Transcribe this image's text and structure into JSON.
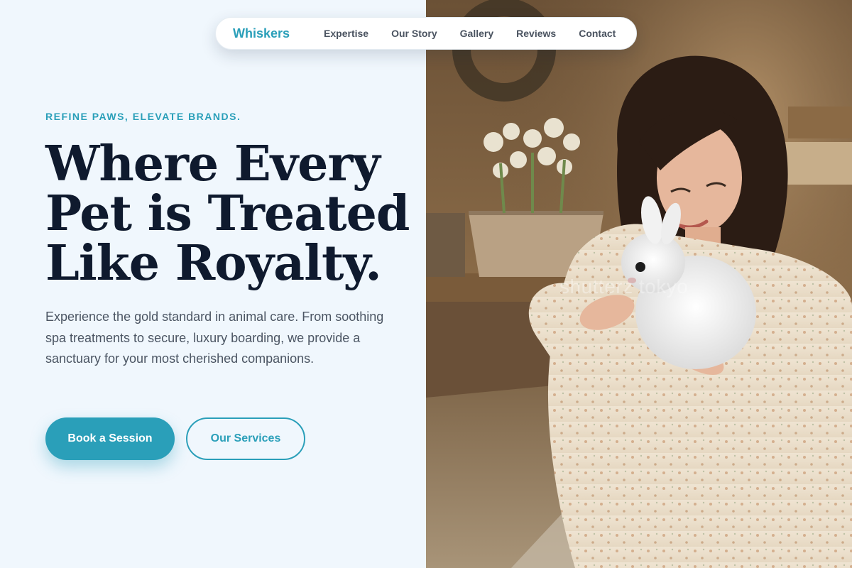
{
  "brand": {
    "name": "Whiskers",
    "accent_color": "#2a9fb9"
  },
  "nav": {
    "items": [
      {
        "label": "Expertise"
      },
      {
        "label": "Our Story"
      },
      {
        "label": "Gallery"
      },
      {
        "label": "Reviews"
      },
      {
        "label": "Contact"
      }
    ]
  },
  "hero": {
    "eyebrow": "REFINE PAWS, ELEVATE BRANDS.",
    "headline_line1": "Where Every",
    "headline_line2": "Pet is Treated",
    "headline_line3": "Like Royalty.",
    "subtext": "Experience the gold standard in animal care. From soothing spa treatments to secure, luxury boarding, we provide a sanctuary for your most cherished companions.",
    "primary_cta": "Book a Session",
    "secondary_cta": "Our Services"
  },
  "photo": {
    "watermark": "shutterz tokyo",
    "subject": "woman-holding-white-rabbit"
  },
  "colors": {
    "background": "#f0f7fd",
    "headline": "#0f1a2e",
    "body_text": "#4b5563"
  }
}
